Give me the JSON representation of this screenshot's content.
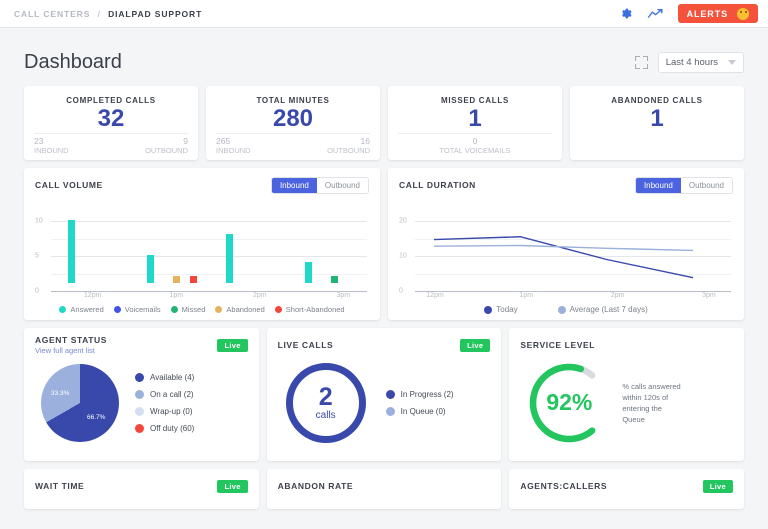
{
  "topbar": {
    "breadcrumb_root": "CALL CENTERS",
    "breadcrumb_sep": "/",
    "breadcrumb_leaf": "DIALPAD SUPPORT",
    "gear_icon": "gear-icon",
    "analytics_icon": "analytics-trend-icon",
    "alerts_label": "ALERTS"
  },
  "page": {
    "title": "Dashboard",
    "expand_icon": "expand-fullscreen-icon",
    "range_value": "Last 4 hours"
  },
  "kpis": [
    {
      "label": "COMPLETED CALLS",
      "value": "32",
      "left_num": "23",
      "left_label": "INBOUND",
      "right_num": "9",
      "right_label": "OUTBOUND"
    },
    {
      "label": "TOTAL MINUTES",
      "value": "280",
      "left_num": "265",
      "left_label": "INBOUND",
      "right_num": "16",
      "right_label": "OUTBOUND"
    },
    {
      "label": "MISSED CALLS",
      "value": "1",
      "mid_num": "0",
      "mid_label": "TOTAL VOICEMAILS"
    },
    {
      "label": "ABANDONED CALLS",
      "value": "1"
    }
  ],
  "call_volume": {
    "title": "CALL VOLUME",
    "toggle_on": "Inbound",
    "toggle_off": "Outbound"
  },
  "call_duration": {
    "title": "CALL DURATION",
    "toggle_on": "Inbound",
    "toggle_off": "Outbound"
  },
  "agent_status": {
    "title": "AGENT STATUS",
    "sublink": "View full agent list",
    "live": "Live",
    "slice_major_pct": "66.7%",
    "slice_minor_pct": "33.3%"
  },
  "live_calls": {
    "title": "LIVE CALLS",
    "live": "Live",
    "center_number": "2",
    "center_unit": "calls"
  },
  "service_level": {
    "title": "SERVICE LEVEL",
    "value": "92%",
    "note": "% calls answered within 120s of entering the Queue"
  },
  "bottom_cards": [
    {
      "title": "WAIT TIME",
      "live": "Live"
    },
    {
      "title": "ABANDON RATE",
      "live": ""
    },
    {
      "title": "AGENTS:CALLERS",
      "live": "Live"
    }
  ],
  "colors": {
    "answered": "#1ed8c8",
    "voicemails": "#4353e8",
    "missed": "#21b573",
    "abandoned": "#e5b35e",
    "short_abandoned": "#f4473b",
    "primary_blue": "#3949ab",
    "light_blue": "#9bb0dc",
    "green": "#22c55e",
    "alert_red": "#f5523c"
  },
  "chart_data": [
    {
      "type": "bar",
      "title": "CALL VOLUME",
      "xlabel": "",
      "ylabel": "",
      "categories": [
        "12pm",
        "1pm",
        "2pm",
        "3pm"
      ],
      "ylim": [
        0,
        10
      ],
      "yticks": [
        0,
        5,
        10
      ],
      "grid": true,
      "legend_position": "bottom",
      "series": [
        {
          "name": "Answered",
          "color": "#1ed8c8",
          "values": [
            9,
            4,
            7,
            3
          ]
        },
        {
          "name": "Voicemails",
          "color": "#4353e8",
          "values": [
            0,
            0,
            0,
            0
          ]
        },
        {
          "name": "Missed",
          "color": "#21b573",
          "values": [
            0,
            0,
            0,
            1
          ]
        },
        {
          "name": "Abandoned",
          "color": "#e5b35e",
          "values": [
            0,
            1,
            0,
            0
          ]
        },
        {
          "name": "Short-Abandoned",
          "color": "#f4473b",
          "values": [
            0,
            1,
            0,
            0
          ]
        }
      ]
    },
    {
      "type": "line",
      "title": "CALL DURATION",
      "xlabel": "",
      "ylabel": "",
      "x": [
        "12pm",
        "1pm",
        "2pm",
        "3pm"
      ],
      "ylim": [
        0,
        20
      ],
      "yticks": [
        0,
        10,
        20
      ],
      "grid": true,
      "legend_position": "bottom",
      "series": [
        {
          "name": "Today",
          "color": "#3949ab",
          "values": [
            14.7,
            15.5,
            9.0,
            3.8
          ]
        },
        {
          "name": "Average (Last 7 days)",
          "color": "#9bb0dc",
          "values": [
            12.8,
            13.0,
            12.2,
            11.6
          ]
        }
      ]
    },
    {
      "type": "pie",
      "title": "AGENT STATUS",
      "labels": [
        "Available (4)",
        "On a call (2)",
        "Wrap-up (0)",
        "Off duty (60)"
      ],
      "values": [
        66.7,
        33.3,
        0,
        0
      ],
      "colors": [
        "#3949ab",
        "#9bb0dc",
        "#d5ddf1",
        "#f4473b"
      ],
      "legend_position": "right"
    },
    {
      "type": "pie",
      "title": "LIVE CALLS",
      "labels": [
        "In Progress (2)",
        "In Queue (0)"
      ],
      "values": [
        2,
        0
      ],
      "colors": [
        "#3949ab",
        "#9bb0dc"
      ],
      "legend_position": "right",
      "center_label": "2 calls"
    },
    {
      "type": "gauge",
      "title": "SERVICE LEVEL",
      "value": 92,
      "ylim": [
        0,
        100
      ],
      "color": "#22c55e",
      "track_color": "#d9dbe0"
    }
  ]
}
